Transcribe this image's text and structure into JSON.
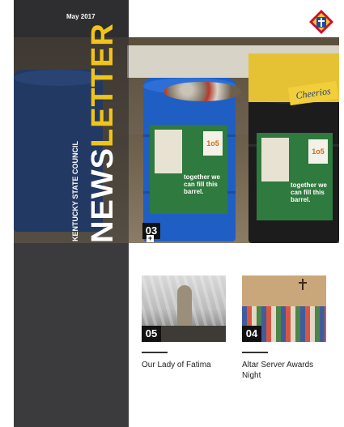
{
  "header": {
    "date": "May 2017",
    "logo_icon": "knights-of-columbus-emblem-icon"
  },
  "masthead": {
    "org": "KENTUCKY STATE COUNCIL",
    "title_part1": "NEWS",
    "title_part2": "LETTER"
  },
  "hero": {
    "number": "03",
    "expand_symbol": "+",
    "poster_text": "together we can fill this barrel.",
    "poster_badge": "1o5",
    "box_brand": "Cheerios"
  },
  "articles": [
    {
      "number": "05",
      "title": "Our Lady of Fatima"
    },
    {
      "number": "04",
      "title": "Altar Server Awards Night"
    }
  ],
  "colors": {
    "sidebar": "#3b3b3d",
    "accent_yellow": "#f0c419",
    "barrel_blue": "#1f5fc4",
    "barrel_black": "#1c1c1c"
  }
}
